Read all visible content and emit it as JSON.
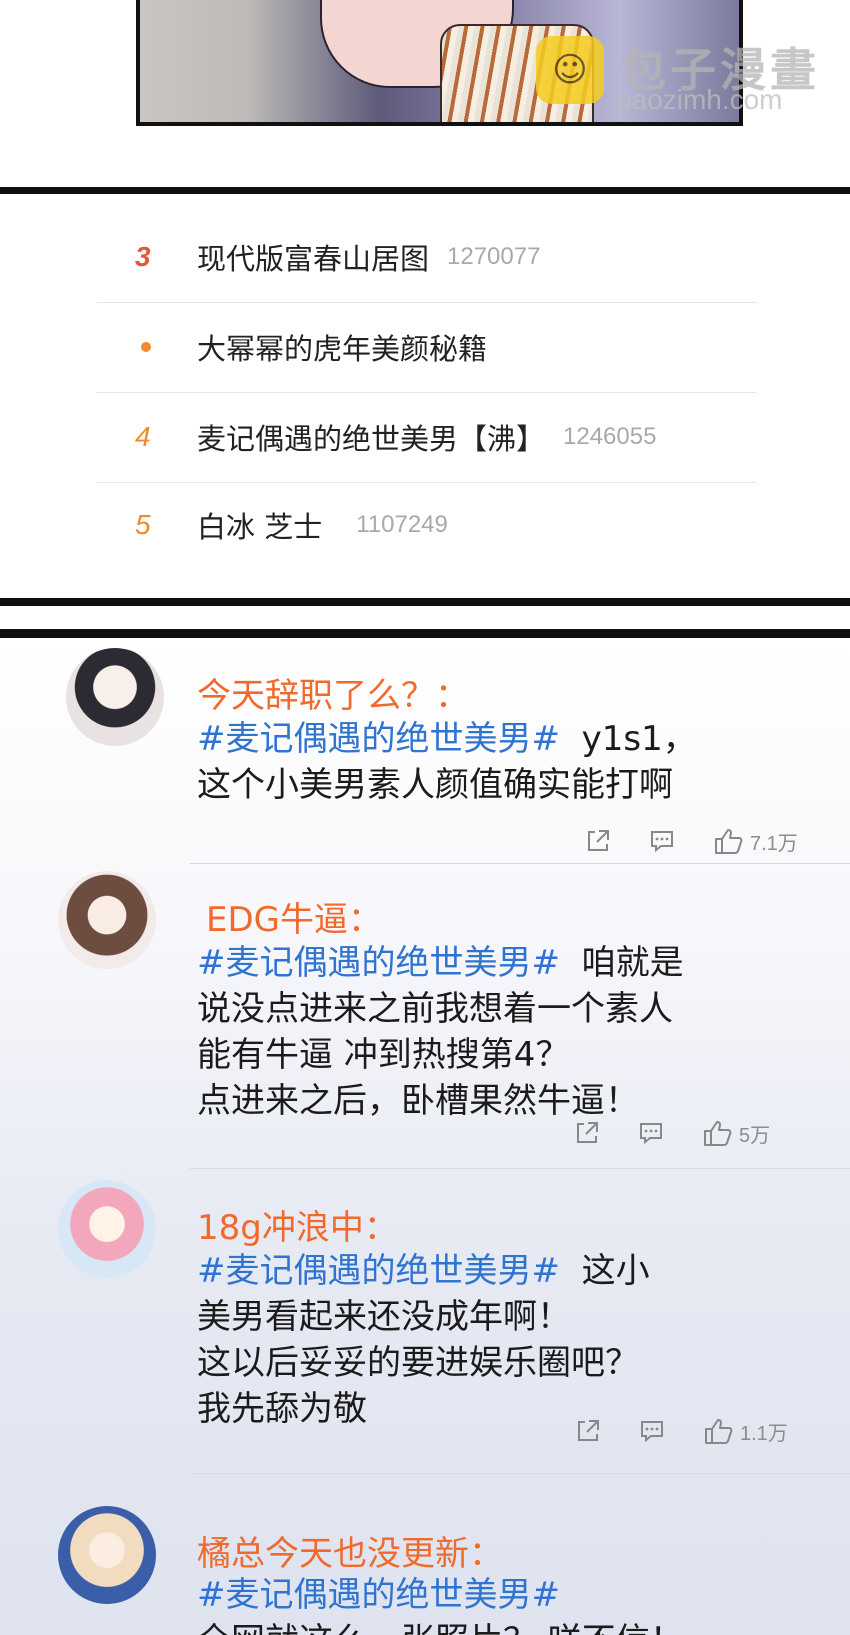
{
  "watermark": {
    "logo_glyph": "☺",
    "title": "包子漫畫",
    "url": "baozimh.com"
  },
  "hot_search": [
    {
      "rank": "3",
      "title": "现代版富春山居图",
      "count": "1270077"
    },
    {
      "rank": "•",
      "title": "大幂幂的虎年美颜秘籍",
      "count": ""
    },
    {
      "rank": "4",
      "title": "麦记偶遇的绝世美男【沸】",
      "count": "1246055"
    },
    {
      "rank": "5",
      "title": "白冰 芝士",
      "count": "1107249"
    }
  ],
  "comments": [
    {
      "user": "今天辞职了么？：",
      "hashtag": "#麦记偶遇的绝世美男#",
      "lines": [
        "y1s1，",
        "这个小美男素人颜值确实能打啊"
      ],
      "likes": "7.1万"
    },
    {
      "user": "EDG牛逼：",
      "hashtag": "#麦记偶遇的绝世美男#",
      "lines": [
        "咱就是",
        "说没点进来之前我想着一个素人",
        "能有牛逼 冲到热搜第4？",
        "点进来之后，卧槽果然牛逼！"
      ],
      "likes": "5万"
    },
    {
      "user": "18g冲浪中：",
      "hashtag": "#麦记偶遇的绝世美男#",
      "lines": [
        "这小",
        "美男看起来还没成年啊！",
        "这以后妥妥的要进娱乐圈吧？",
        "我先舔为敬"
      ],
      "likes": "1.1万"
    },
    {
      "user": "橘总今天也没更新：",
      "hashtag": "#麦记偶遇的绝世美男#",
      "lines": [
        "全网就这么一张照片？ 咩不信！"
      ],
      "likes": ""
    }
  ],
  "colors": {
    "username": "#f06a2c",
    "hashtag": "#2f74d0",
    "rank_orange": "#f08a2b",
    "rank_top": "#e2573e"
  },
  "icons": [
    "share-icon",
    "comment-icon",
    "thumbs-up-icon"
  ]
}
